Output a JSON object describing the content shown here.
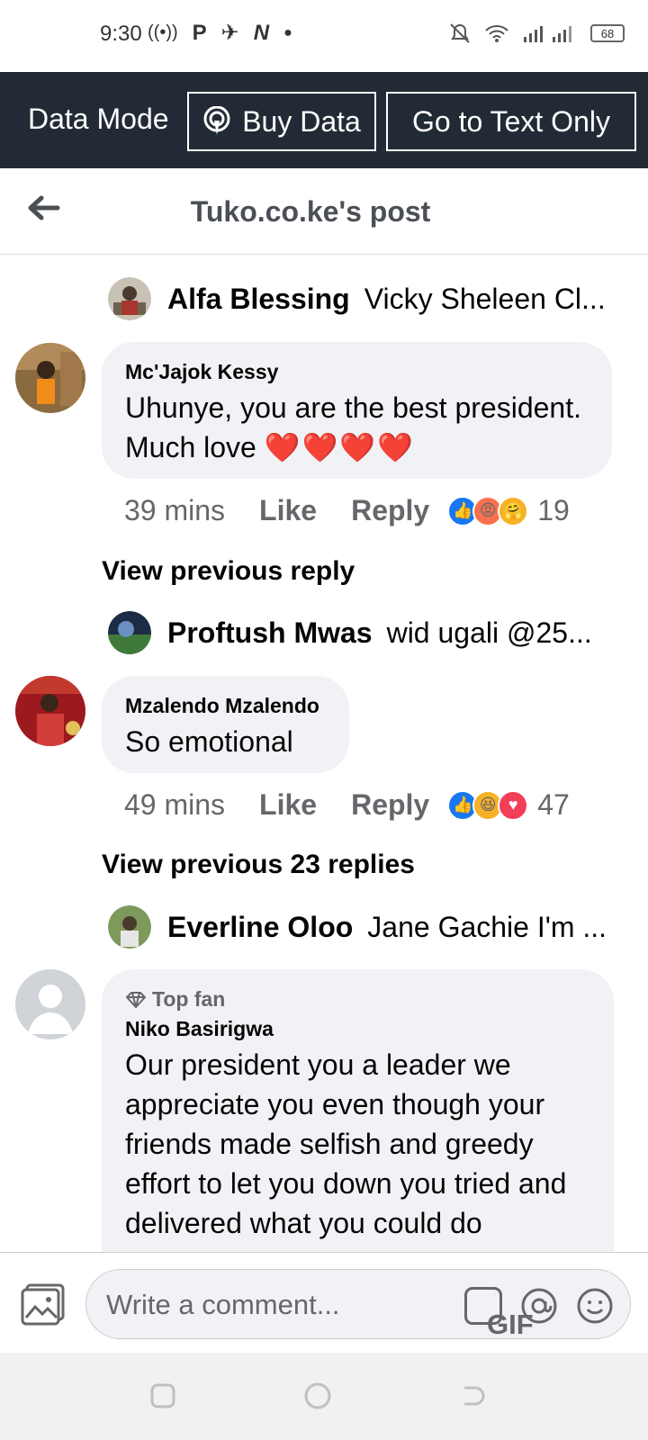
{
  "status_bar": {
    "time": "9:30",
    "battery": "68"
  },
  "data_bar": {
    "mode_label": "Data Mode",
    "buy_data_label": "Buy Data",
    "text_only_label": "Go to Text Only"
  },
  "header": {
    "title": "Tuko.co.ke's post"
  },
  "reply_previews": [
    {
      "name": "Alfa Blessing",
      "text": "Vicky Sheleen Cl..."
    },
    {
      "name": "Proftush Mwas",
      "text": "wid ugali @25..."
    },
    {
      "name": "Everline Oloo",
      "text": "Jane Gachie I'm ..."
    }
  ],
  "comments": [
    {
      "name": "Mc'Jajok Kessy",
      "text": "Uhunye, you are the best president. Much love",
      "hearts": "❤️❤️❤️❤️",
      "time": "39 mins",
      "like": "Like",
      "reply": "Reply",
      "reaction_count": "19",
      "reactions": [
        "like",
        "angry",
        "care"
      ]
    },
    {
      "name": "Mzalendo Mzalendo",
      "text": "So emotional",
      "time": "49 mins",
      "like": "Like",
      "reply": "Reply",
      "reaction_count": "47",
      "reactions": [
        "like",
        "haha",
        "love"
      ]
    },
    {
      "badge": "Top fan",
      "name": "Niko Basirigwa",
      "text": "Our president you a leader we appreciate you even though your friends made selfish and greedy effort to let you down you tried and delivered what you could do"
    }
  ],
  "view_previous": [
    "View previous reply",
    "View previous 23 replies"
  ],
  "composer": {
    "placeholder": "Write a comment...",
    "gif_label": "GIF"
  },
  "colors": {
    "data_bar": "#222b35",
    "bubble": "#f0f2f5",
    "like_blue": "#1877f2",
    "secondary_text": "#65676b"
  }
}
